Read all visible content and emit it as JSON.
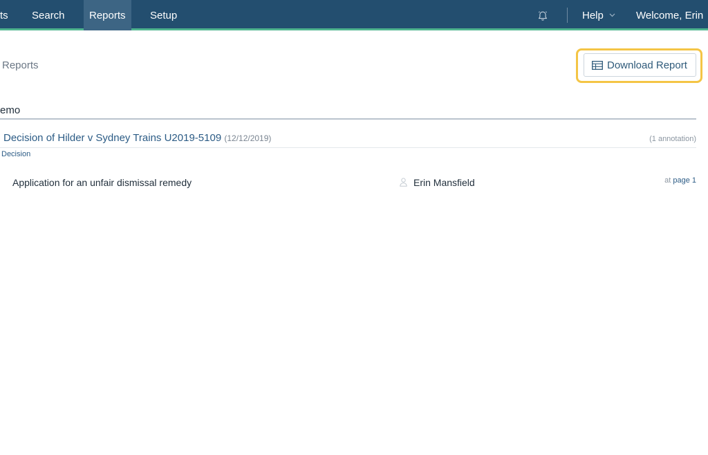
{
  "nav": {
    "items": [
      {
        "label": "ts"
      },
      {
        "label": "Search"
      },
      {
        "label": "Reports",
        "active": true
      },
      {
        "label": "Setup"
      }
    ],
    "help_label": "Help",
    "welcome": "Welcome, Erin",
    "icons": {
      "notifications": "bell-icon",
      "help_dropdown": "chevron-down-icon"
    }
  },
  "page": {
    "breadcrumb": "Reports",
    "download_label": "Download Report",
    "download_icon": "table-icon",
    "highlight_color": "#f4c545"
  },
  "section": {
    "title": "emo"
  },
  "document": {
    "title": "Decision of Hilder v Sydney Trains U2019-5109",
    "date": "(12/12/2019)",
    "annotation_count": "(1 annotation)",
    "tag": "Decision"
  },
  "annotation": {
    "text": "Application for an unfair dismissal remedy",
    "user": "Erin Mansfield",
    "user_icon": "user-icon",
    "page_prefix": "at",
    "page_label": "page 1"
  },
  "colors": {
    "nav_bg": "#234e6f",
    "nav_active_bg": "#3d6584",
    "nav_accent": "#4fb48e",
    "link": "#2b5b85"
  }
}
